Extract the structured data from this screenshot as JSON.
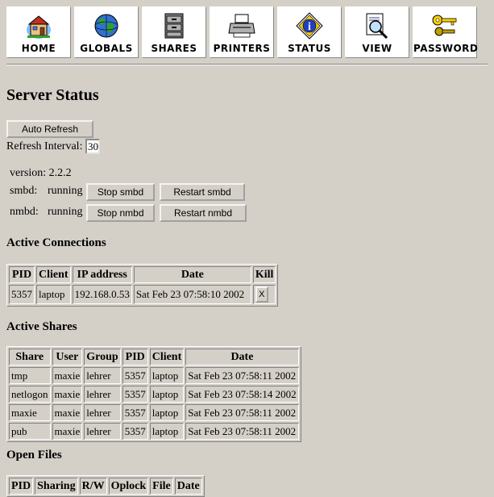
{
  "nav": [
    {
      "label": "HOME",
      "icon": "home-icon"
    },
    {
      "label": "GLOBALS",
      "icon": "globe-icon"
    },
    {
      "label": "SHARES",
      "icon": "file-cabinet-icon"
    },
    {
      "label": "PRINTERS",
      "icon": "printer-icon"
    },
    {
      "label": "STATUS",
      "icon": "info-icon"
    },
    {
      "label": "VIEW",
      "icon": "magnifier-icon"
    },
    {
      "label": "PASSWORD",
      "icon": "keys-icon"
    }
  ],
  "page_title": "Server Status",
  "auto_refresh_label": "Auto Refresh",
  "refresh_interval_label": "Refresh Interval:",
  "refresh_interval_value": "30",
  "version_text": "version: 2.2.2",
  "smbd": {
    "label": "smbd:",
    "status": "running",
    "stop": "Stop smbd",
    "restart": "Restart smbd"
  },
  "nmbd": {
    "label": "nmbd:",
    "status": "running",
    "stop": "Stop nmbd",
    "restart": "Restart nmbd"
  },
  "connections": {
    "title": "Active Connections",
    "headers": [
      "PID",
      "Client",
      "IP address",
      "Date",
      "Kill"
    ],
    "rows": [
      {
        "pid": "5357",
        "client": "laptop",
        "ip": "192.168.0.53",
        "date": "Sat Feb 23 07:58:10 2002",
        "kill": "X"
      }
    ]
  },
  "shares": {
    "title": "Active Shares",
    "headers": [
      "Share",
      "User",
      "Group",
      "PID",
      "Client",
      "Date"
    ],
    "rows": [
      {
        "share": "tmp",
        "user": "maxie",
        "group": "lehrer",
        "pid": "5357",
        "client": "laptop",
        "date": "Sat Feb 23 07:58:11 2002"
      },
      {
        "share": "netlogon",
        "user": "maxie",
        "group": "lehrer",
        "pid": "5357",
        "client": "laptop",
        "date": "Sat Feb 23 07:58:14 2002"
      },
      {
        "share": "maxie",
        "user": "maxie",
        "group": "lehrer",
        "pid": "5357",
        "client": "laptop",
        "date": "Sat Feb 23 07:58:11 2002"
      },
      {
        "share": "pub",
        "user": "maxie",
        "group": "lehrer",
        "pid": "5357",
        "client": "laptop",
        "date": "Sat Feb 23 07:58:11 2002"
      }
    ]
  },
  "open_files": {
    "title": "Open Files",
    "headers": [
      "PID",
      "Sharing",
      "R/W",
      "Oplock",
      "File",
      "Date"
    ]
  }
}
